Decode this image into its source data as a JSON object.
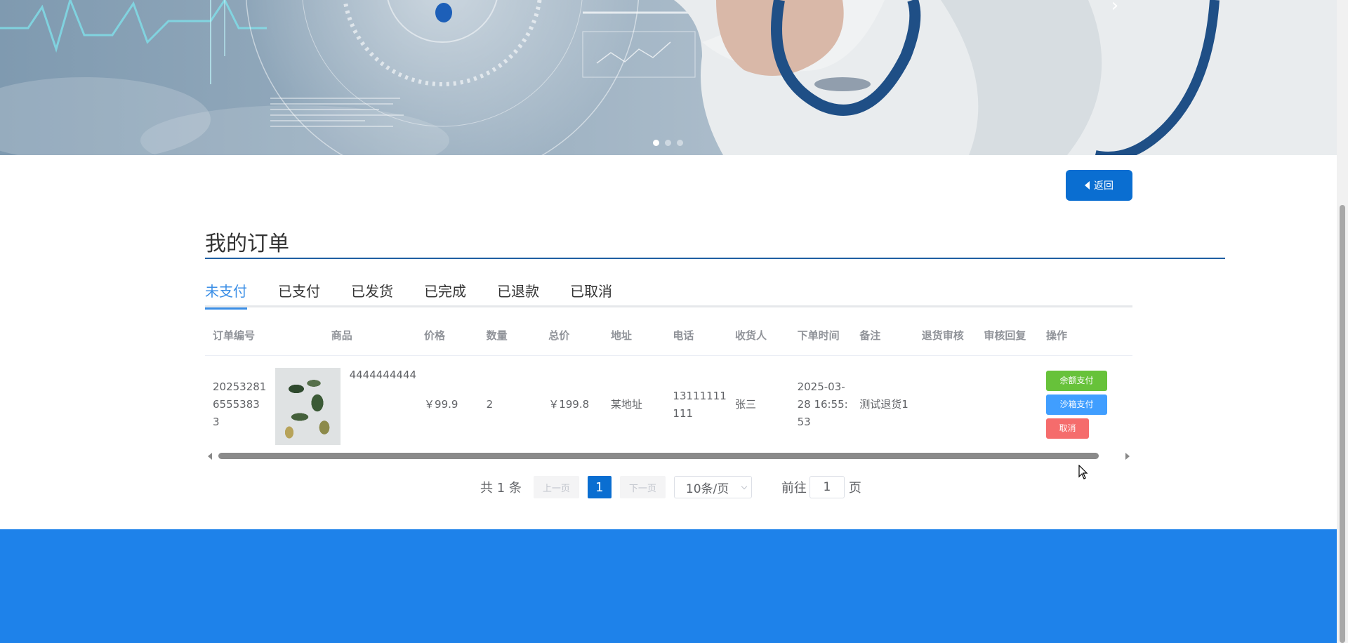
{
  "banner": {
    "next_arrow_glyph": "›",
    "slides": 3,
    "active_slide": 1
  },
  "back_button": {
    "label": "返回",
    "icon": "caret-left-icon"
  },
  "page_title": "我的订单",
  "tabs": [
    {
      "label": "未支付",
      "active": true
    },
    {
      "label": "已支付",
      "active": false
    },
    {
      "label": "已发货",
      "active": false
    },
    {
      "label": "已完成",
      "active": false
    },
    {
      "label": "已退款",
      "active": false
    },
    {
      "label": "已取消",
      "active": false
    }
  ],
  "table": {
    "headers": {
      "order_no": "订单编号",
      "product": "商品",
      "price": "价格",
      "quantity": "数量",
      "total": "总价",
      "address": "地址",
      "phone": "电话",
      "receiver": "收货人",
      "order_time": "下单时间",
      "remark": "备注",
      "refund_review": "退货审核",
      "review_reply": "审核回复",
      "actions": "操作"
    },
    "rows": [
      {
        "order_no": "202532816555383 3",
        "product_name": "4444444444",
        "price": "￥99.9",
        "quantity": "2",
        "total": "￥199.8",
        "address": "某地址",
        "phone": "13111111111",
        "receiver": "张三",
        "order_time": "2025-03-28 16:55:53",
        "remark": "测试退货1",
        "refund_review": "",
        "review_reply": "",
        "actions": {
          "pay_balance": "余额支付",
          "pay_sandbox": "沙箱支付",
          "cancel": "取消"
        }
      }
    ]
  },
  "pagination": {
    "total_text": "共 1 条",
    "prev_label": "上一页",
    "current_page": "1",
    "next_label": "下一页",
    "page_size": "10条/页",
    "goto_label": "前往",
    "goto_value": "1",
    "page_suffix": "页"
  },
  "colors": {
    "primary": "#0a6ed1",
    "tab_active": "#3a8ee6",
    "success": "#67c23a",
    "info": "#409eff",
    "danger": "#f56c6c",
    "footer": "#1e82ea"
  }
}
